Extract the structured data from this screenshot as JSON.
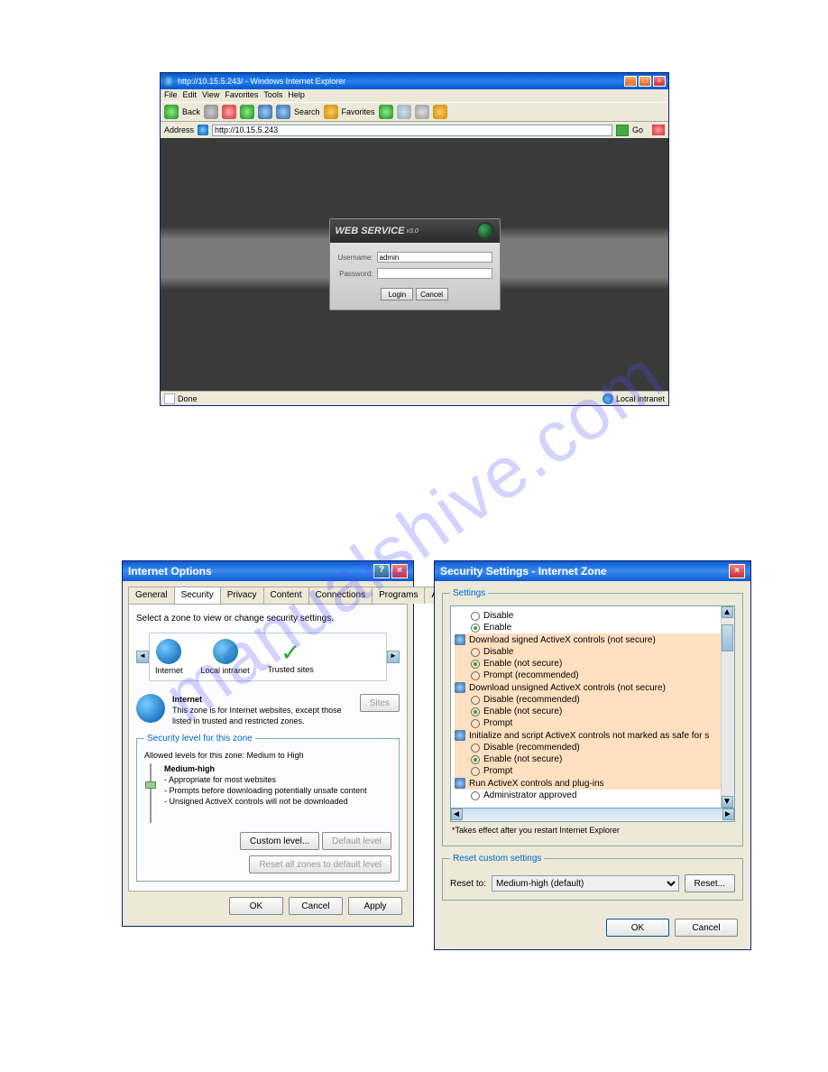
{
  "watermark": "manualshive.com",
  "ie_window": {
    "title": "http://10.15.5.243/ - Windows Internet Explorer",
    "menu": [
      "File",
      "Edit",
      "View",
      "Favorites",
      "Tools",
      "Help"
    ],
    "toolbar": {
      "back": "Back",
      "search": "Search",
      "favorites": "Favorites"
    },
    "address_label": "Address",
    "address_value": "http://10.15.5.243",
    "go_label": "Go",
    "status_left": "Done",
    "status_right": "Local intranet"
  },
  "login": {
    "header": "WEB  SERVICE",
    "version": "v3.0",
    "username_label": "Username:",
    "username_value": "admin",
    "password_label": "Password:",
    "password_value": "",
    "login_btn": "Login",
    "cancel_btn": "Cancel"
  },
  "internet_options": {
    "title": "Internet Options",
    "tabs": [
      "General",
      "Security",
      "Privacy",
      "Content",
      "Connections",
      "Programs",
      "Advanced"
    ],
    "active_tab": 1,
    "instruction": "Select a zone to view or change security settings.",
    "zones": {
      "internet": "Internet",
      "local_intranet": "Local intranet",
      "trusted_sites": "Trusted sites"
    },
    "zone_desc": {
      "heading": "Internet",
      "text": "This zone is for Internet websites, except those listed in trusted and restricted zones."
    },
    "sites_btn": "Sites",
    "security_level_legend": "Security level for this zone",
    "allowed_text": "Allowed levels for this zone: Medium to High",
    "level_name": "Medium-high",
    "level_bullets": [
      "- Appropriate for most websites",
      "- Prompts before downloading potentially unsafe content",
      "- Unsigned ActiveX controls will not be downloaded"
    ],
    "custom_level_btn": "Custom level...",
    "default_level_btn": "Default level",
    "reset_all_btn": "Reset all zones to default level",
    "ok_btn": "OK",
    "cancel_btn": "Cancel",
    "apply_btn": "Apply"
  },
  "security_settings": {
    "title": "Security Settings - Internet Zone",
    "settings_legend": "Settings",
    "groups": [
      {
        "header": null,
        "highlight": false,
        "options": [
          {
            "label": "Disable",
            "selected": false,
            "highlight": false
          },
          {
            "label": "Enable",
            "selected": true,
            "highlight": false
          }
        ]
      },
      {
        "header": "Download signed ActiveX controls (not secure)",
        "highlight": true,
        "options": [
          {
            "label": "Disable",
            "selected": false,
            "highlight": true
          },
          {
            "label": "Enable (not secure)",
            "selected": true,
            "highlight": true
          },
          {
            "label": "Prompt (recommended)",
            "selected": false,
            "highlight": true
          }
        ]
      },
      {
        "header": "Download unsigned ActiveX controls (not secure)",
        "highlight": true,
        "options": [
          {
            "label": "Disable (recommended)",
            "selected": false,
            "highlight": true
          },
          {
            "label": "Enable (not secure)",
            "selected": true,
            "highlight": true
          },
          {
            "label": "Prompt",
            "selected": false,
            "highlight": true
          }
        ]
      },
      {
        "header": "Initialize and script ActiveX controls not marked as safe for s",
        "highlight": true,
        "options": [
          {
            "label": "Disable (recommended)",
            "selected": false,
            "highlight": true
          },
          {
            "label": "Enable (not secure)",
            "selected": true,
            "highlight": true
          },
          {
            "label": "Prompt",
            "selected": false,
            "highlight": true
          }
        ]
      },
      {
        "header": "Run ActiveX controls and plug-ins",
        "highlight": true,
        "options": [
          {
            "label": "Administrator approved",
            "selected": false,
            "highlight": false
          }
        ]
      }
    ],
    "note": "*Takes effect after you restart Internet Explorer",
    "reset_legend": "Reset custom settings",
    "reset_to_label": "Reset to:",
    "reset_to_value": "Medium-high (default)",
    "reset_btn": "Reset...",
    "ok_btn": "OK",
    "cancel_btn": "Cancel"
  }
}
